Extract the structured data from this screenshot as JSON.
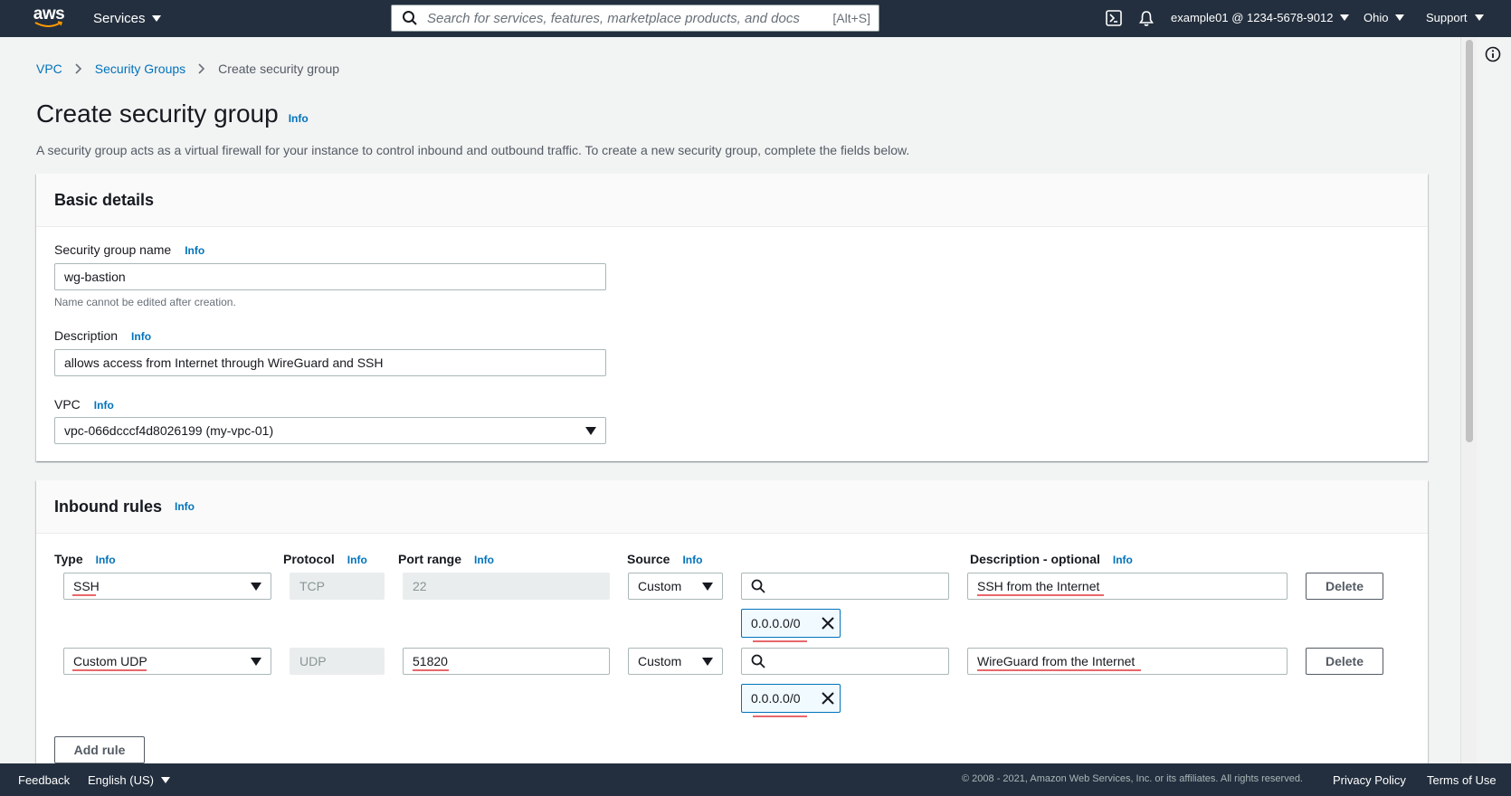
{
  "topnav": {
    "logo_text": "aws",
    "services_label": "Services",
    "search_placeholder": "Search for services, features, marketplace products, and docs",
    "search_shortcut": "[Alt+S]",
    "account": "example01 @ 1234-5678-9012",
    "region": "Ohio",
    "support": "Support",
    "icons": [
      "cloudshell-icon",
      "bell-icon",
      "search-icon"
    ]
  },
  "breadcrumb": {
    "items": [
      "VPC",
      "Security Groups"
    ],
    "current": "Create security group"
  },
  "page": {
    "title": "Create security group",
    "title_info": "Info",
    "description": "A security group acts as a virtual firewall for your instance to control inbound and outbound traffic. To create a new security group, complete the fields below."
  },
  "basic_details": {
    "heading": "Basic details",
    "name_label": "Security group name",
    "name_info": "Info",
    "name_value": "wg-bastion",
    "name_constraint": "Name cannot be edited after creation.",
    "desc_label": "Description",
    "desc_info": "Info",
    "desc_value": "allows access from Internet through WireGuard and SSH",
    "vpc_label": "VPC",
    "vpc_info": "Info",
    "vpc_value": "vpc-066dcccf4d8026199 (my-vpc-01)"
  },
  "inbound": {
    "heading": "Inbound rules",
    "heading_info": "Info",
    "columns": {
      "type": "Type",
      "protocol": "Protocol",
      "port_range": "Port range",
      "source": "Source",
      "description": "Description - optional",
      "info": "Info"
    },
    "rules": [
      {
        "type": "SSH",
        "protocol": "TCP",
        "port_range": "22",
        "source": "Custom",
        "cidr": "0.0.0.0/0",
        "description": "SSH from the Internet",
        "delete_label": "Delete"
      },
      {
        "type": "Custom UDP",
        "protocol": "UDP",
        "port_range": "51820",
        "source": "Custom",
        "cidr": "0.0.0.0/0",
        "description": "WireGuard from the Internet",
        "delete_label": "Delete"
      }
    ],
    "add_rule_label": "Add rule"
  },
  "footer": {
    "feedback": "Feedback",
    "language": "English (US)",
    "copyright": "© 2008 - 2021, Amazon Web Services, Inc. or its affiliates. All rights reserved.",
    "privacy": "Privacy Policy",
    "terms": "Terms of Use"
  },
  "colors": {
    "nav_bg": "#232f3e",
    "link": "#0073bb",
    "page_bg": "#f2f3f3",
    "token_bg": "#f1faff",
    "spellcheck": "#e8676b"
  }
}
